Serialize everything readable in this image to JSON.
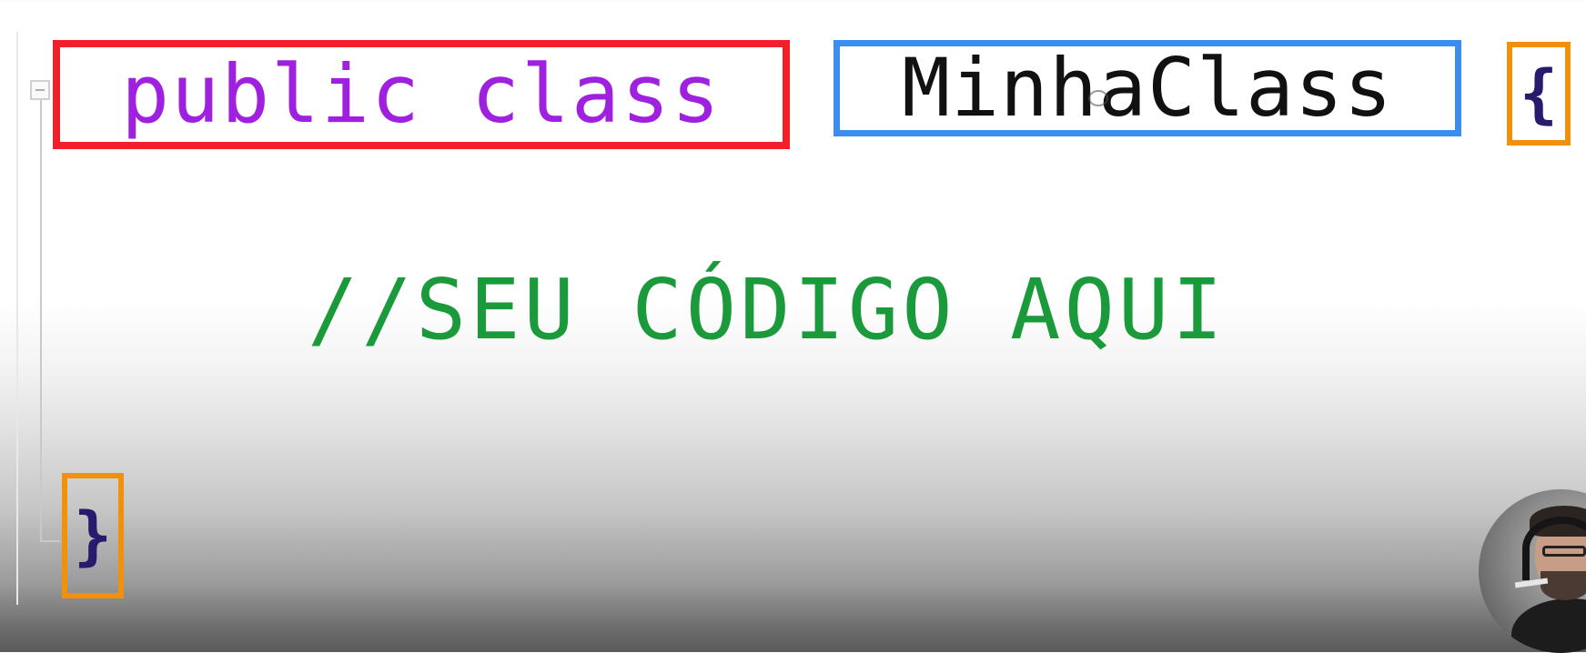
{
  "editor": {
    "keyword_text": "public class",
    "class_name": "MinhaClass",
    "open_brace": "{",
    "comment": "//SEU CÓDIGO AQUI",
    "close_brace": "}"
  },
  "colors": {
    "keyword": "#a020e0",
    "identifier": "#111111",
    "comment": "#1a9a3a",
    "brace": "#2a1a6e",
    "keyword_highlight": "#f0202a",
    "class_highlight": "#3b8ef0",
    "brace_highlight": "#f0900c"
  },
  "webcam": {
    "icon": "presenter-webcam-overlay"
  }
}
